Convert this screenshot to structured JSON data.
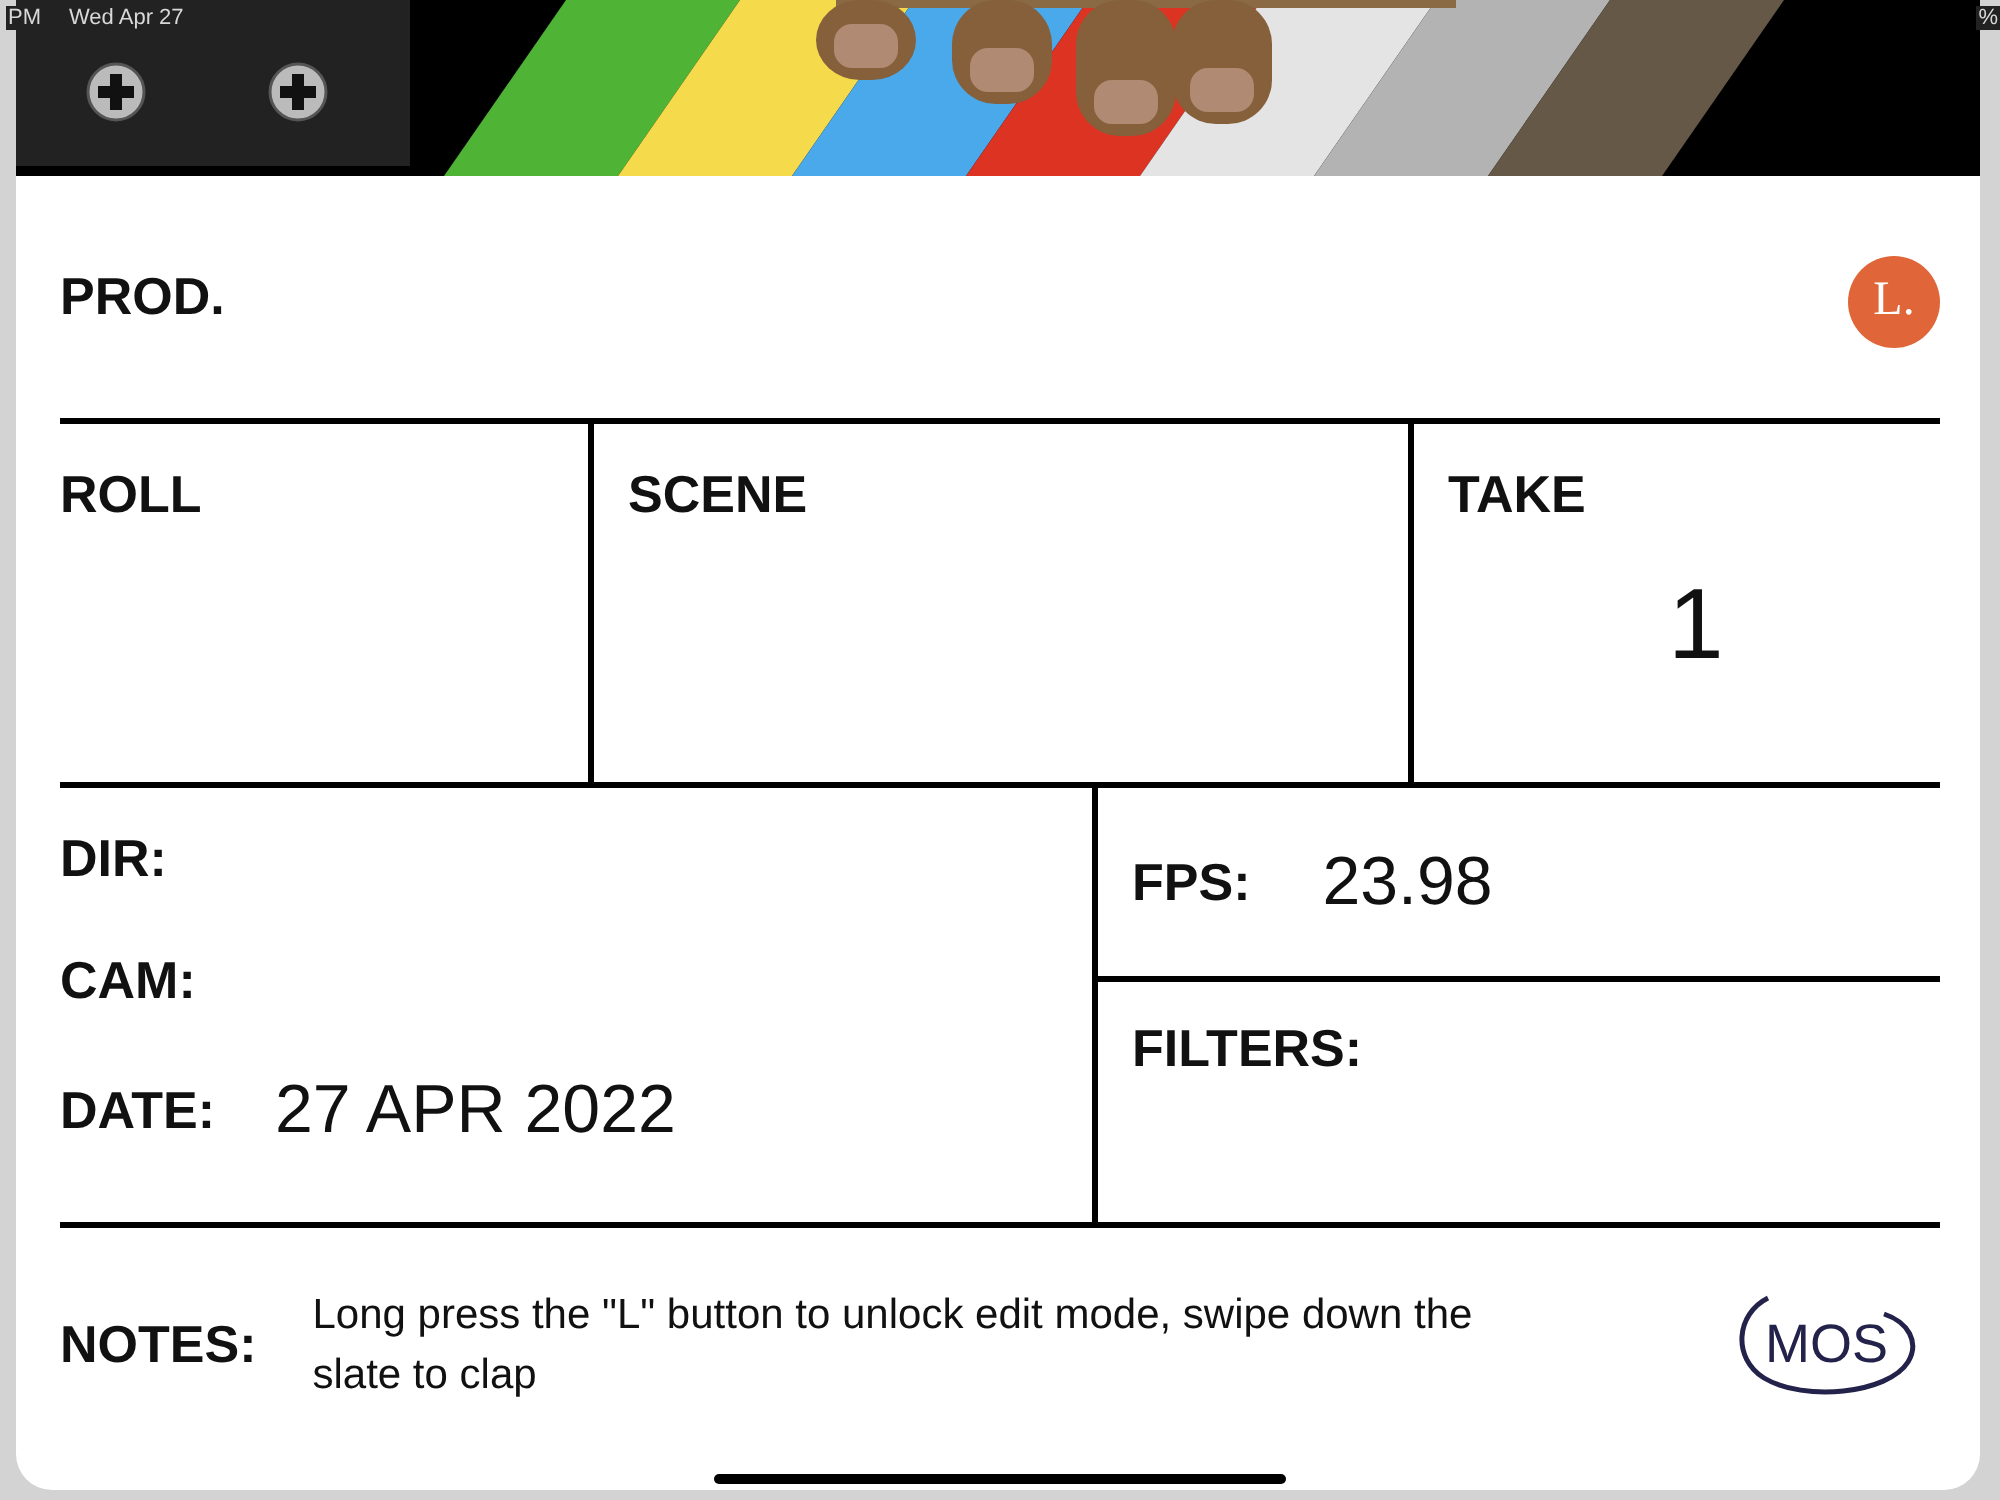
{
  "status_bar": {
    "time": "PM",
    "date": "Wed Apr 27",
    "battery": "%"
  },
  "prod": {
    "label": "PROD."
  },
  "lock_button": {
    "label": "L."
  },
  "roll": {
    "label": "ROLL"
  },
  "scene": {
    "label": "SCENE"
  },
  "take": {
    "label": "TAKE",
    "value": "1"
  },
  "dir": {
    "label": "DIR:"
  },
  "cam": {
    "label": "CAM:"
  },
  "date": {
    "label": "DATE:",
    "value": "27 APR 2022"
  },
  "fps": {
    "label": "FPS:",
    "value": "23.98"
  },
  "filters": {
    "label": "FILTERS:"
  },
  "notes": {
    "label": "NOTES:",
    "text": "Long press the \"L\" button to unlock edit mode, swipe down the slate to clap"
  },
  "mos_button": {
    "label": "MOS"
  }
}
